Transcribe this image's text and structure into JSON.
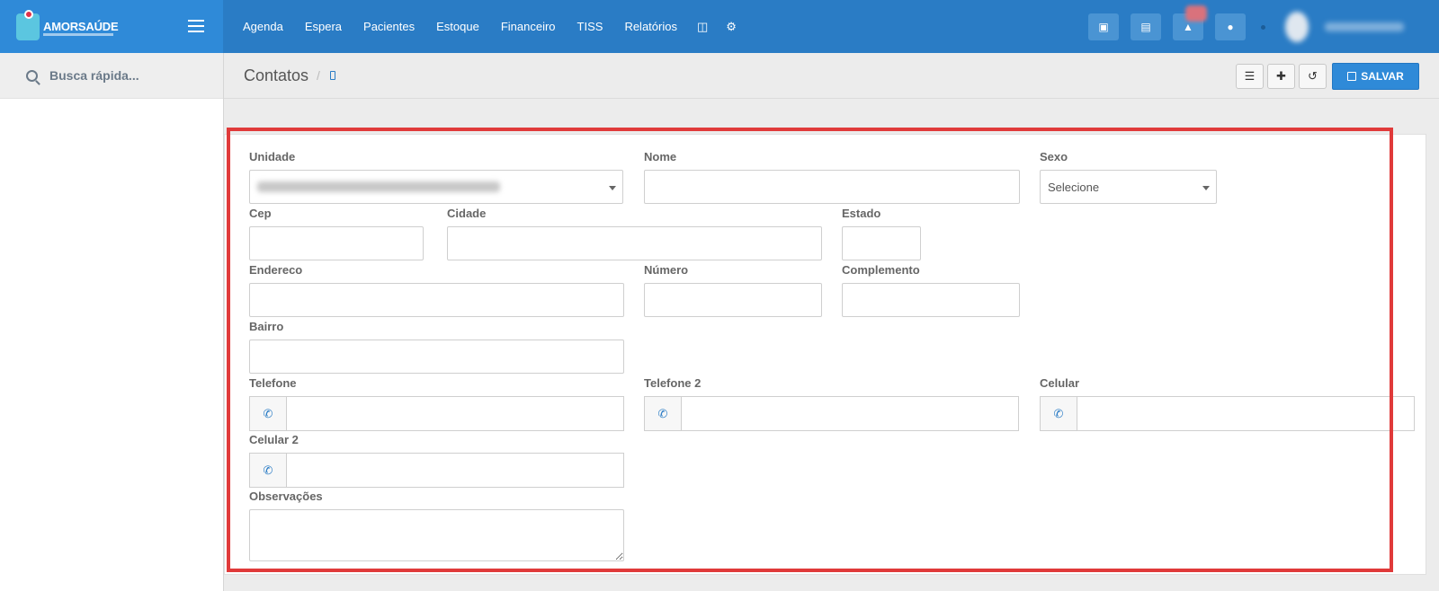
{
  "app": {
    "brand": "AMORSAÚDE"
  },
  "nav": {
    "items": [
      "Agenda",
      "Espera",
      "Pacientes",
      "Estoque",
      "Financeiro",
      "TISS",
      "Relatórios"
    ],
    "icons": [
      "database-icon",
      "gear-icon"
    ]
  },
  "top_right": {
    "buttons": [
      "inbox-icon",
      "card-icon",
      "bell-icon",
      "chat-icon"
    ]
  },
  "sidebar": {
    "search_placeholder": "Busca rápida..."
  },
  "header": {
    "title": "Contatos",
    "breadcrumb_sep": "/"
  },
  "actions": {
    "save_label": "SALVAR",
    "icons": [
      "list-icon",
      "plus-icon",
      "history-icon"
    ]
  },
  "form": {
    "unidade": {
      "label": "Unidade"
    },
    "nome": {
      "label": "Nome",
      "value": ""
    },
    "sexo": {
      "label": "Sexo",
      "value": "Selecione"
    },
    "cep": {
      "label": "Cep",
      "value": ""
    },
    "cidade": {
      "label": "Cidade",
      "value": ""
    },
    "estado": {
      "label": "Estado",
      "value": ""
    },
    "endereco": {
      "label": "Endereco",
      "value": ""
    },
    "numero": {
      "label": "Número",
      "value": ""
    },
    "complemento": {
      "label": "Complemento",
      "value": ""
    },
    "bairro": {
      "label": "Bairro",
      "value": ""
    },
    "telefone": {
      "label": "Telefone",
      "value": ""
    },
    "telefone2": {
      "label": "Telefone 2",
      "value": ""
    },
    "celular": {
      "label": "Celular",
      "value": ""
    },
    "celular2": {
      "label": "Celular 2",
      "value": ""
    },
    "observacoes": {
      "label": "Observações",
      "value": ""
    }
  },
  "colors": {
    "navbar": "#2a7cc5",
    "brand_bg": "#2f8ad8",
    "primary": "#2f8ad8",
    "highlight": "#e03a3a"
  }
}
